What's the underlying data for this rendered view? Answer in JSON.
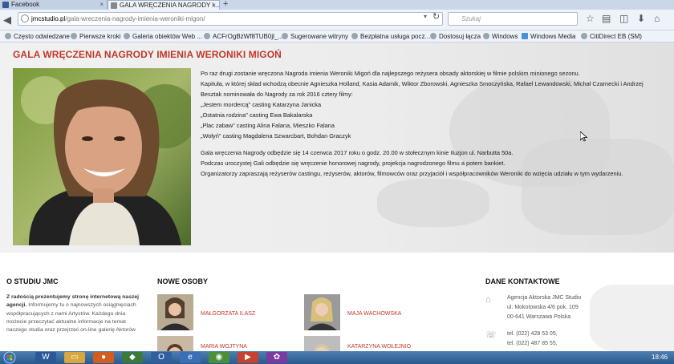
{
  "tabs": [
    {
      "label": "Facebook",
      "icon": "facebook-icon"
    },
    {
      "label": "GALA WRĘCZENIA NAGRODY I...",
      "icon": "page-icon"
    }
  ],
  "tab_close": "×",
  "new_tab": "+",
  "address": {
    "domain": "jmcstudio.pl",
    "path": "/gala-wreczenia-nagrody-imienia-weroniki-migon/"
  },
  "search_placeholder": "Szukaj",
  "bookmarks": [
    "Często odwiedzane",
    "Pierwsze kroki",
    "Galeria obiektów Web ...",
    "ACFrOgBzWf8TUB0jl_...",
    "Sugerowane witryny",
    "Bezpłatna usługa pocz...",
    "Dostosuj łącza",
    "Windows",
    "Windows Media",
    "CitiDirect EB (SM)"
  ],
  "page": {
    "title": "GALA WRĘCZENIA NAGRODY IMIENIA WERONIKI MIGOŃ",
    "paragraphs": [
      "Po raz drugi zostanie wręczona Nagroda imienia Weroniki Migoń dla najlepszego reżysera obsady aktorskiej w filmie polskim minionego sezonu.",
      "Kapituła, w której skład wchodzą obecnie Agnieszka Holland, Kasia Adamik, Wiktor Zborowski, Agnieszka Smoczyńska, Rafael Lewandowski, Michał Czarnecki i Andrzej",
      "Besztak nominowała do Nagrody za rok 2016 cztery filmy:",
      "„Jestem mordercą\" casting Katarzyna Janicka",
      "„Ostatnia rodzina\" casting Ewa Bakalarska",
      "„Plac zabaw\" casting Alina Falana, Mieszko Falana",
      "„Wołyń\" casting Magdalena Szwarcbart, Bohdan Graczyk"
    ],
    "paragraphs2": [
      "Gala wręczenia Nagrody odbędzie się 14 czerwca 2017 roku o godz. 20.00 w stołecznym kinie Iluzjon ul. Narbutta 50a.",
      "Podczas uroczystej Gali odbędzie się wręczenie honorowej nagrody, projekcja nagrodzonego filmu a potem bankiet.",
      "Organizatorzy zapraszają reżyserów castingu, reżyserów, aktorów, filmowców oraz przyjaciół i współpracowników Weroniki do wzięcia udziału w tym wydarzeniu."
    ]
  },
  "footer": {
    "about_heading": "O STUDIU JMC",
    "about_lead": "Z radością prezentujemy stronę internetową naszej agencji.",
    "about_text": "Informujemy tu o najnowszych osiągnięciach współpracujących z nami Artystów. Każdego dnia możecie przeczytać aktualne informacje na temat naszego studia oraz przejrzeć on-line galerię Aktorów",
    "people_heading": "NOWE OSOBY",
    "people": [
      "MAŁGORZATA ILASZ",
      "MAJA WACHOWSKA",
      "MARIA WOJTYNA",
      "KATARZYNA WOŁEJNIO"
    ],
    "contact_heading": "DANE KONTAKTOWE",
    "contact_lines": [
      "Agencja Aktorska JMC Studio",
      "ul. Mokotowska 4/6 pok. 109",
      "00-641 Warszawa Polska"
    ],
    "phone_lines": [
      "tel. (022) 428 53 05,",
      "tel. (022) 487 85 55,"
    ]
  },
  "taskbar": {
    "time": "18:46"
  },
  "colors": {
    "accent": "#c0392b",
    "taskbar": "#2a5a8d"
  }
}
